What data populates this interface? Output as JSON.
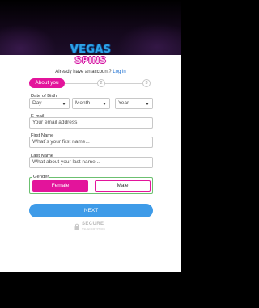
{
  "brand": {
    "line1": "VEGAS",
    "line2": "SPINS",
    "primary_color": "#2ea3e8",
    "accent_color": "#e3149b"
  },
  "account_prompt": {
    "text": "Already have an account?",
    "link": "Log in"
  },
  "steps": {
    "active_label": "About you",
    "step2": "2",
    "step3": "3"
  },
  "dob": {
    "label": "Date of Birth",
    "day": "Day",
    "month": "Month",
    "year": "Year"
  },
  "email": {
    "label": "E-mail",
    "placeholder": "Your email address"
  },
  "first_name": {
    "label": "First Name",
    "placeholder": "What´s your first name..."
  },
  "last_name": {
    "label": "Last Name",
    "placeholder": "What about your last name..."
  },
  "gender": {
    "label": "Gender",
    "female": "Female",
    "male": "Male",
    "selected": "Female"
  },
  "next_button": "NEXT",
  "secure_badge": {
    "title": "SECURE",
    "subtitle": "SSL ENCRYPTION"
  }
}
